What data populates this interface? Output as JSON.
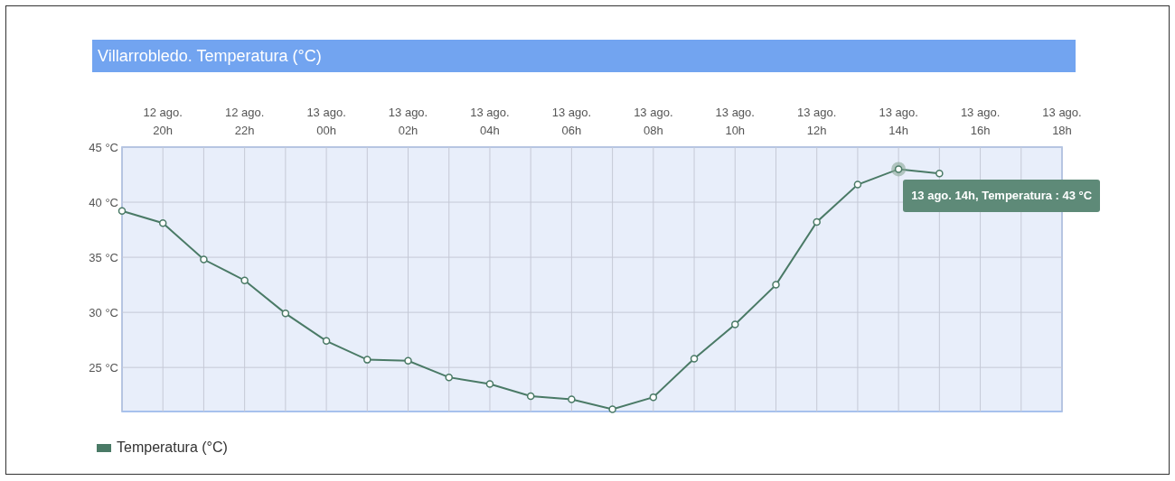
{
  "chart_panel": {
    "title": "Villarrobledo. Temperatura (°C)",
    "chart_data": {
      "type": "line",
      "grid": true,
      "ylim": [
        21,
        45
      ],
      "categories": [
        null,
        "12 ago.\n20h",
        null,
        "12 ago.\n22h",
        null,
        "13 ago.\n00h",
        null,
        "13 ago.\n02h",
        null,
        "13 ago.\n04h",
        null,
        "13 ago.\n06h",
        null,
        "13 ago.\n08h",
        null,
        "13 ago.\n10h",
        null,
        "13 ago.\n12h",
        null,
        "13 ago.\n14h",
        null,
        "13 ago.\n16h",
        null,
        "13 ago.\n18h"
      ],
      "yticks": [
        {
          "value": 25,
          "label": "25 °C"
        },
        {
          "value": 30,
          "label": "30 °C"
        },
        {
          "value": 35,
          "label": "35 °C"
        },
        {
          "value": 40,
          "label": "40 °C"
        },
        {
          "value": 45,
          "label": "45 °C"
        }
      ],
      "series": [
        {
          "name": "Temperatura (°C)",
          "color": "#4a7a66",
          "marker": true,
          "values": [
            39.2,
            38.1,
            34.8,
            32.9,
            29.9,
            27.4,
            25.7,
            25.6,
            24.1,
            23.5,
            22.4,
            22.1,
            21.2,
            22.3,
            25.8,
            28.9,
            32.5,
            38.2,
            41.6,
            43.0,
            42.6,
            null,
            null,
            null
          ]
        }
      ]
    },
    "tooltip": {
      "text": "13 ago. 14h, Temperatura : 43 °C"
    }
  }
}
